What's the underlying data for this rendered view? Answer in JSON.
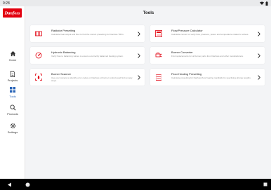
{
  "status_bar": {
    "time": "9:28"
  },
  "sidebar": {
    "logo_text": "Danfoss",
    "items": [
      {
        "label": "Home",
        "icon": "home-icon"
      },
      {
        "label": "Projects",
        "icon": "document-icon"
      },
      {
        "label": "Tools",
        "icon": "grid-icon",
        "active": true
      },
      {
        "label": "Products",
        "icon": "search-icon"
      },
      {
        "label": "Settings",
        "icon": "gear-icon"
      }
    ]
  },
  "page": {
    "title": "Tools"
  },
  "tools": [
    {
      "title": "Radiator Presetting",
      "description": "Calculate heat output and flow to find the correct presetting for Danfoss TRVs.",
      "icon": "radiator-icon"
    },
    {
      "title": "Flow/Pressure Calculator",
      "description": "Calculate convert or verify flow, pressure, power and temperature related to valves.",
      "icon": "gauge-icon"
    },
    {
      "title": "Hydronic Balancing",
      "description": "Verify flow to balancing valves to ensure a correctly balanced heating system.",
      "icon": "balancing-icon"
    },
    {
      "title": "Burner Converter",
      "description": "Find replacements for oil burner parts from Danfoss and other manufacturers.",
      "icon": "burner-nozzle-icon"
    },
    {
      "title": "Burner Scanner",
      "description": "Use your camera to identify error codes on Danfoss oil burner controls and find remedy steps.",
      "icon": "burner-scan-icon"
    },
    {
      "title": "Floor Heating Presetting",
      "description": "Calculate presetting for Danfoss floor heating manifolds by specifying all pipe lengths.",
      "icon": "floor-heating-icon"
    }
  ],
  "colors": {
    "brand": "#e2000f",
    "active_nav": "#2a65b8",
    "background": "#f3f4f6"
  }
}
